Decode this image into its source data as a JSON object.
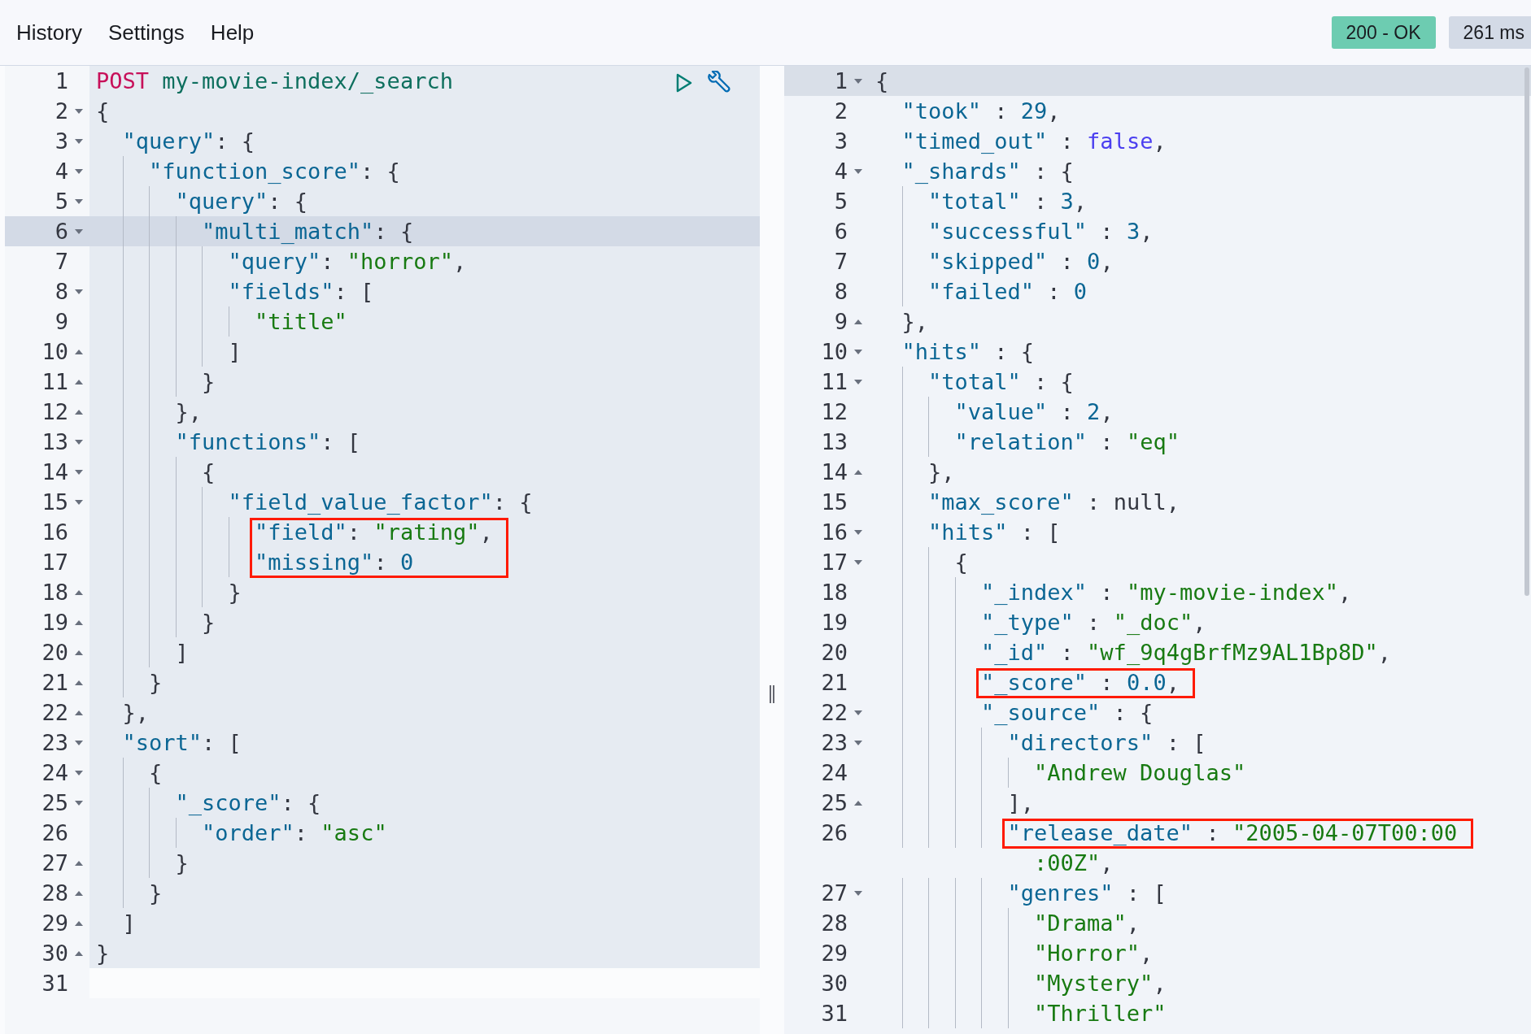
{
  "menu": [
    {
      "label": "History"
    },
    {
      "label": "Settings"
    },
    {
      "label": "Help"
    }
  ],
  "status": {
    "label": "200 - OK",
    "kind": "success"
  },
  "timing": {
    "label": "261 ms"
  },
  "request_editor": {
    "lines": [
      {
        "number": "1",
        "kind": "plain",
        "selected": true,
        "active": false,
        "tokens": [
          {
            "kind": "method",
            "text": "POST "
          },
          {
            "kind": "url",
            "text": "my-movie-index/_search"
          }
        ]
      },
      {
        "number": "2",
        "kind": "fold-start",
        "selected": true,
        "active": false,
        "tokens": [
          {
            "kind": "punct",
            "text": "{"
          }
        ]
      },
      {
        "number": "3",
        "kind": "fold-start",
        "selected": true,
        "active": false,
        "tokens": [
          {
            "kind": "key",
            "text": "  \"query\""
          },
          {
            "kind": "punct",
            "text": ": {"
          }
        ]
      },
      {
        "number": "4",
        "kind": "fold-start",
        "selected": true,
        "active": false,
        "tokens": [
          {
            "kind": "key",
            "text": "    \"function_score\""
          },
          {
            "kind": "punct",
            "text": ": {"
          }
        ]
      },
      {
        "number": "5",
        "kind": "fold-start",
        "selected": true,
        "active": false,
        "tokens": [
          {
            "kind": "key",
            "text": "      \"query\""
          },
          {
            "kind": "punct",
            "text": ": {"
          }
        ]
      },
      {
        "number": "6",
        "kind": "fold-start",
        "selected": true,
        "active": true,
        "tokens": [
          {
            "kind": "key",
            "text": "        \"multi_match\""
          },
          {
            "kind": "punct",
            "text": ": {"
          }
        ]
      },
      {
        "number": "7",
        "kind": "plain",
        "selected": true,
        "active": false,
        "tokens": [
          {
            "kind": "key",
            "text": "          \"query\""
          },
          {
            "kind": "punct",
            "text": ": "
          },
          {
            "kind": "string",
            "text": "\"horror\""
          },
          {
            "kind": "punct",
            "text": ","
          }
        ]
      },
      {
        "number": "8",
        "kind": "fold-start",
        "selected": true,
        "active": false,
        "tokens": [
          {
            "kind": "key",
            "text": "          \"fields\""
          },
          {
            "kind": "punct",
            "text": ": ["
          }
        ]
      },
      {
        "number": "9",
        "kind": "plain",
        "selected": true,
        "active": false,
        "tokens": [
          {
            "kind": "string",
            "text": "            \"title\""
          }
        ]
      },
      {
        "number": "10",
        "kind": "fold-end",
        "selected": true,
        "active": false,
        "tokens": [
          {
            "kind": "punct",
            "text": "          ]"
          }
        ]
      },
      {
        "number": "11",
        "kind": "fold-end",
        "selected": true,
        "active": false,
        "tokens": [
          {
            "kind": "punct",
            "text": "        }"
          }
        ]
      },
      {
        "number": "12",
        "kind": "fold-end",
        "selected": true,
        "active": false,
        "tokens": [
          {
            "kind": "punct",
            "text": "      },"
          }
        ]
      },
      {
        "number": "13",
        "kind": "fold-start",
        "selected": true,
        "active": false,
        "tokens": [
          {
            "kind": "key",
            "text": "      \"functions\""
          },
          {
            "kind": "punct",
            "text": ": ["
          }
        ]
      },
      {
        "number": "14",
        "kind": "fold-start",
        "selected": true,
        "active": false,
        "tokens": [
          {
            "kind": "punct",
            "text": "        {"
          }
        ]
      },
      {
        "number": "15",
        "kind": "fold-start",
        "selected": true,
        "active": false,
        "tokens": [
          {
            "kind": "key",
            "text": "          \"field_value_factor\""
          },
          {
            "kind": "punct",
            "text": ": {"
          }
        ]
      },
      {
        "number": "16",
        "kind": "plain",
        "selected": true,
        "active": false,
        "boxed": true,
        "tokens": [
          {
            "kind": "key",
            "text": "            \"field\""
          },
          {
            "kind": "punct",
            "text": ": "
          },
          {
            "kind": "string",
            "text": "\"rating\""
          },
          {
            "kind": "punct",
            "text": ","
          }
        ]
      },
      {
        "number": "17",
        "kind": "plain",
        "selected": true,
        "active": false,
        "boxed": true,
        "tokens": [
          {
            "kind": "key",
            "text": "            \"missing\""
          },
          {
            "kind": "punct",
            "text": ": "
          },
          {
            "kind": "number",
            "text": "0"
          }
        ]
      },
      {
        "number": "18",
        "kind": "fold-end",
        "selected": true,
        "active": false,
        "tokens": [
          {
            "kind": "punct",
            "text": "          }"
          }
        ]
      },
      {
        "number": "19",
        "kind": "fold-end",
        "selected": true,
        "active": false,
        "tokens": [
          {
            "kind": "punct",
            "text": "        }"
          }
        ]
      },
      {
        "number": "20",
        "kind": "fold-end",
        "selected": true,
        "active": false,
        "tokens": [
          {
            "kind": "punct",
            "text": "      ]"
          }
        ]
      },
      {
        "number": "21",
        "kind": "fold-end",
        "selected": true,
        "active": false,
        "tokens": [
          {
            "kind": "punct",
            "text": "    }"
          }
        ]
      },
      {
        "number": "22",
        "kind": "fold-end",
        "selected": true,
        "active": false,
        "tokens": [
          {
            "kind": "punct",
            "text": "  },"
          }
        ]
      },
      {
        "number": "23",
        "kind": "fold-start",
        "selected": true,
        "active": false,
        "tokens": [
          {
            "kind": "key",
            "text": "  \"sort\""
          },
          {
            "kind": "punct",
            "text": ": ["
          }
        ]
      },
      {
        "number": "24",
        "kind": "fold-start",
        "selected": true,
        "active": false,
        "tokens": [
          {
            "kind": "punct",
            "text": "    {"
          }
        ]
      },
      {
        "number": "25",
        "kind": "fold-start",
        "selected": true,
        "active": false,
        "tokens": [
          {
            "kind": "key",
            "text": "      \"_score\""
          },
          {
            "kind": "punct",
            "text": ": {"
          }
        ]
      },
      {
        "number": "26",
        "kind": "plain",
        "selected": true,
        "active": false,
        "tokens": [
          {
            "kind": "key",
            "text": "        \"order\""
          },
          {
            "kind": "punct",
            "text": ": "
          },
          {
            "kind": "string",
            "text": "\"asc\""
          }
        ]
      },
      {
        "number": "27",
        "kind": "fold-end",
        "selected": true,
        "active": false,
        "tokens": [
          {
            "kind": "punct",
            "text": "      }"
          }
        ]
      },
      {
        "number": "28",
        "kind": "fold-end",
        "selected": true,
        "active": false,
        "tokens": [
          {
            "kind": "punct",
            "text": "    }"
          }
        ]
      },
      {
        "number": "29",
        "kind": "fold-end",
        "selected": true,
        "active": false,
        "tokens": [
          {
            "kind": "punct",
            "text": "  ]"
          }
        ]
      },
      {
        "number": "30",
        "kind": "fold-end",
        "selected": true,
        "active": false,
        "tokens": [
          {
            "kind": "punct",
            "text": "}"
          }
        ]
      },
      {
        "number": "31",
        "kind": "plain",
        "selected": false,
        "active": false
      }
    ]
  },
  "response_editor": {
    "lines": [
      {
        "number": "1",
        "kind": "fold-start",
        "active": true,
        "tokens": [
          {
            "kind": "punct",
            "text": "{"
          }
        ]
      },
      {
        "number": "2",
        "kind": "plain",
        "active": false,
        "tokens": [
          {
            "kind": "key",
            "text": "  \"took\""
          },
          {
            "kind": "punct",
            "text": " : "
          },
          {
            "kind": "number",
            "text": "29"
          },
          {
            "kind": "punct",
            "text": ","
          }
        ]
      },
      {
        "number": "3",
        "kind": "plain",
        "active": false,
        "tokens": [
          {
            "kind": "key",
            "text": "  \"timed_out\""
          },
          {
            "kind": "punct",
            "text": " : "
          },
          {
            "kind": "boolean",
            "text": "false"
          },
          {
            "kind": "punct",
            "text": ","
          }
        ]
      },
      {
        "number": "4",
        "kind": "fold-start",
        "active": false,
        "tokens": [
          {
            "kind": "key",
            "text": "  \"_shards\""
          },
          {
            "kind": "punct",
            "text": " : {"
          }
        ]
      },
      {
        "number": "5",
        "kind": "plain",
        "active": false,
        "tokens": [
          {
            "kind": "key",
            "text": "    \"total\""
          },
          {
            "kind": "punct",
            "text": " : "
          },
          {
            "kind": "number",
            "text": "3"
          },
          {
            "kind": "punct",
            "text": ","
          }
        ]
      },
      {
        "number": "6",
        "kind": "plain",
        "active": false,
        "tokens": [
          {
            "kind": "key",
            "text": "    \"successful\""
          },
          {
            "kind": "punct",
            "text": " : "
          },
          {
            "kind": "number",
            "text": "3"
          },
          {
            "kind": "punct",
            "text": ","
          }
        ]
      },
      {
        "number": "7",
        "kind": "plain",
        "active": false,
        "tokens": [
          {
            "kind": "key",
            "text": "    \"skipped\""
          },
          {
            "kind": "punct",
            "text": " : "
          },
          {
            "kind": "number",
            "text": "0"
          },
          {
            "kind": "punct",
            "text": ","
          }
        ]
      },
      {
        "number": "8",
        "kind": "plain",
        "active": false,
        "tokens": [
          {
            "kind": "key",
            "text": "    \"failed\""
          },
          {
            "kind": "punct",
            "text": " : "
          },
          {
            "kind": "number",
            "text": "0"
          }
        ]
      },
      {
        "number": "9",
        "kind": "fold-end",
        "active": false,
        "tokens": [
          {
            "kind": "punct",
            "text": "  },"
          }
        ]
      },
      {
        "number": "10",
        "kind": "fold-start",
        "active": false,
        "tokens": [
          {
            "kind": "key",
            "text": "  \"hits\""
          },
          {
            "kind": "punct",
            "text": " : {"
          }
        ]
      },
      {
        "number": "11",
        "kind": "fold-start",
        "active": false,
        "tokens": [
          {
            "kind": "key",
            "text": "    \"total\""
          },
          {
            "kind": "punct",
            "text": " : {"
          }
        ]
      },
      {
        "number": "12",
        "kind": "plain",
        "active": false,
        "tokens": [
          {
            "kind": "key",
            "text": "      \"value\""
          },
          {
            "kind": "punct",
            "text": " : "
          },
          {
            "kind": "number",
            "text": "2"
          },
          {
            "kind": "punct",
            "text": ","
          }
        ]
      },
      {
        "number": "13",
        "kind": "plain",
        "active": false,
        "tokens": [
          {
            "kind": "key",
            "text": "      \"relation\""
          },
          {
            "kind": "punct",
            "text": " : "
          },
          {
            "kind": "string",
            "text": "\"eq\""
          }
        ]
      },
      {
        "number": "14",
        "kind": "fold-end",
        "active": false,
        "tokens": [
          {
            "kind": "punct",
            "text": "    },"
          }
        ]
      },
      {
        "number": "15",
        "kind": "plain",
        "active": false,
        "tokens": [
          {
            "kind": "key",
            "text": "    \"max_score\""
          },
          {
            "kind": "punct",
            "text": " : "
          },
          {
            "kind": "null",
            "text": "null"
          },
          {
            "kind": "punct",
            "text": ","
          }
        ]
      },
      {
        "number": "16",
        "kind": "fold-start",
        "active": false,
        "tokens": [
          {
            "kind": "key",
            "text": "    \"hits\""
          },
          {
            "kind": "punct",
            "text": " : ["
          }
        ]
      },
      {
        "number": "17",
        "kind": "fold-start",
        "active": false,
        "tokens": [
          {
            "kind": "punct",
            "text": "      {"
          }
        ]
      },
      {
        "number": "18",
        "kind": "plain",
        "active": false,
        "tokens": [
          {
            "kind": "key",
            "text": "        \"_index\""
          },
          {
            "kind": "punct",
            "text": " : "
          },
          {
            "kind": "string",
            "text": "\"my-movie-index\""
          },
          {
            "kind": "punct",
            "text": ","
          }
        ]
      },
      {
        "number": "19",
        "kind": "plain",
        "active": false,
        "tokens": [
          {
            "kind": "key",
            "text": "        \"_type\""
          },
          {
            "kind": "punct",
            "text": " : "
          },
          {
            "kind": "string",
            "text": "\"_doc\""
          },
          {
            "kind": "punct",
            "text": ","
          }
        ]
      },
      {
        "number": "20",
        "kind": "plain",
        "active": false,
        "tokens": [
          {
            "kind": "key",
            "text": "        \"_id\""
          },
          {
            "kind": "punct",
            "text": " : "
          },
          {
            "kind": "string",
            "text": "\"wf_9q4gBrfMz9AL1Bp8D\""
          },
          {
            "kind": "punct",
            "text": ","
          }
        ]
      },
      {
        "number": "21",
        "kind": "plain",
        "active": false,
        "boxed": true,
        "tokens": [
          {
            "kind": "key",
            "text": "        \"_score\""
          },
          {
            "kind": "punct",
            "text": " : "
          },
          {
            "kind": "number",
            "text": "0.0"
          },
          {
            "kind": "punct",
            "text": ","
          }
        ]
      },
      {
        "number": "22",
        "kind": "fold-start",
        "active": false,
        "tokens": [
          {
            "kind": "key",
            "text": "        \"_source\""
          },
          {
            "kind": "punct",
            "text": " : {"
          }
        ]
      },
      {
        "number": "23",
        "kind": "fold-start",
        "active": false,
        "tokens": [
          {
            "kind": "key",
            "text": "          \"directors\""
          },
          {
            "kind": "punct",
            "text": " : ["
          }
        ]
      },
      {
        "number": "24",
        "kind": "plain",
        "active": false,
        "tokens": [
          {
            "kind": "string",
            "text": "            \"Andrew Douglas\""
          }
        ]
      },
      {
        "number": "25",
        "kind": "fold-end",
        "active": false,
        "tokens": [
          {
            "kind": "punct",
            "text": "          ],"
          }
        ]
      },
      {
        "number": "26",
        "kind": "plain",
        "active": false,
        "boxed": true,
        "tokens": [
          {
            "kind": "key",
            "text": "          \"release_date\""
          },
          {
            "kind": "punct",
            "text": " : "
          },
          {
            "kind": "string",
            "text": "\"2005-04-07T00:00"
          }
        ],
        "continuation": [
          {
            "kind": "string",
            "text": ":00Z\""
          },
          {
            "kind": "punct",
            "text": ","
          }
        ]
      },
      {
        "number": "27",
        "kind": "fold-start",
        "active": false,
        "tokens": [
          {
            "kind": "key",
            "text": "          \"genres\""
          },
          {
            "kind": "punct",
            "text": " : ["
          }
        ]
      },
      {
        "number": "28",
        "kind": "plain",
        "active": false,
        "tokens": [
          {
            "kind": "string",
            "text": "            \"Drama\""
          },
          {
            "kind": "punct",
            "text": ","
          }
        ]
      },
      {
        "number": "29",
        "kind": "plain",
        "active": false,
        "tokens": [
          {
            "kind": "string",
            "text": "            \"Horror\""
          },
          {
            "kind": "punct",
            "text": ","
          }
        ]
      },
      {
        "number": "30",
        "kind": "plain",
        "active": false,
        "tokens": [
          {
            "kind": "string",
            "text": "            \"Mystery\""
          },
          {
            "kind": "punct",
            "text": ","
          }
        ]
      },
      {
        "number": "31",
        "kind": "plain",
        "active": false,
        "tokens": [
          {
            "kind": "string",
            "text": "            \"Thriller\""
          }
        ]
      }
    ]
  }
}
